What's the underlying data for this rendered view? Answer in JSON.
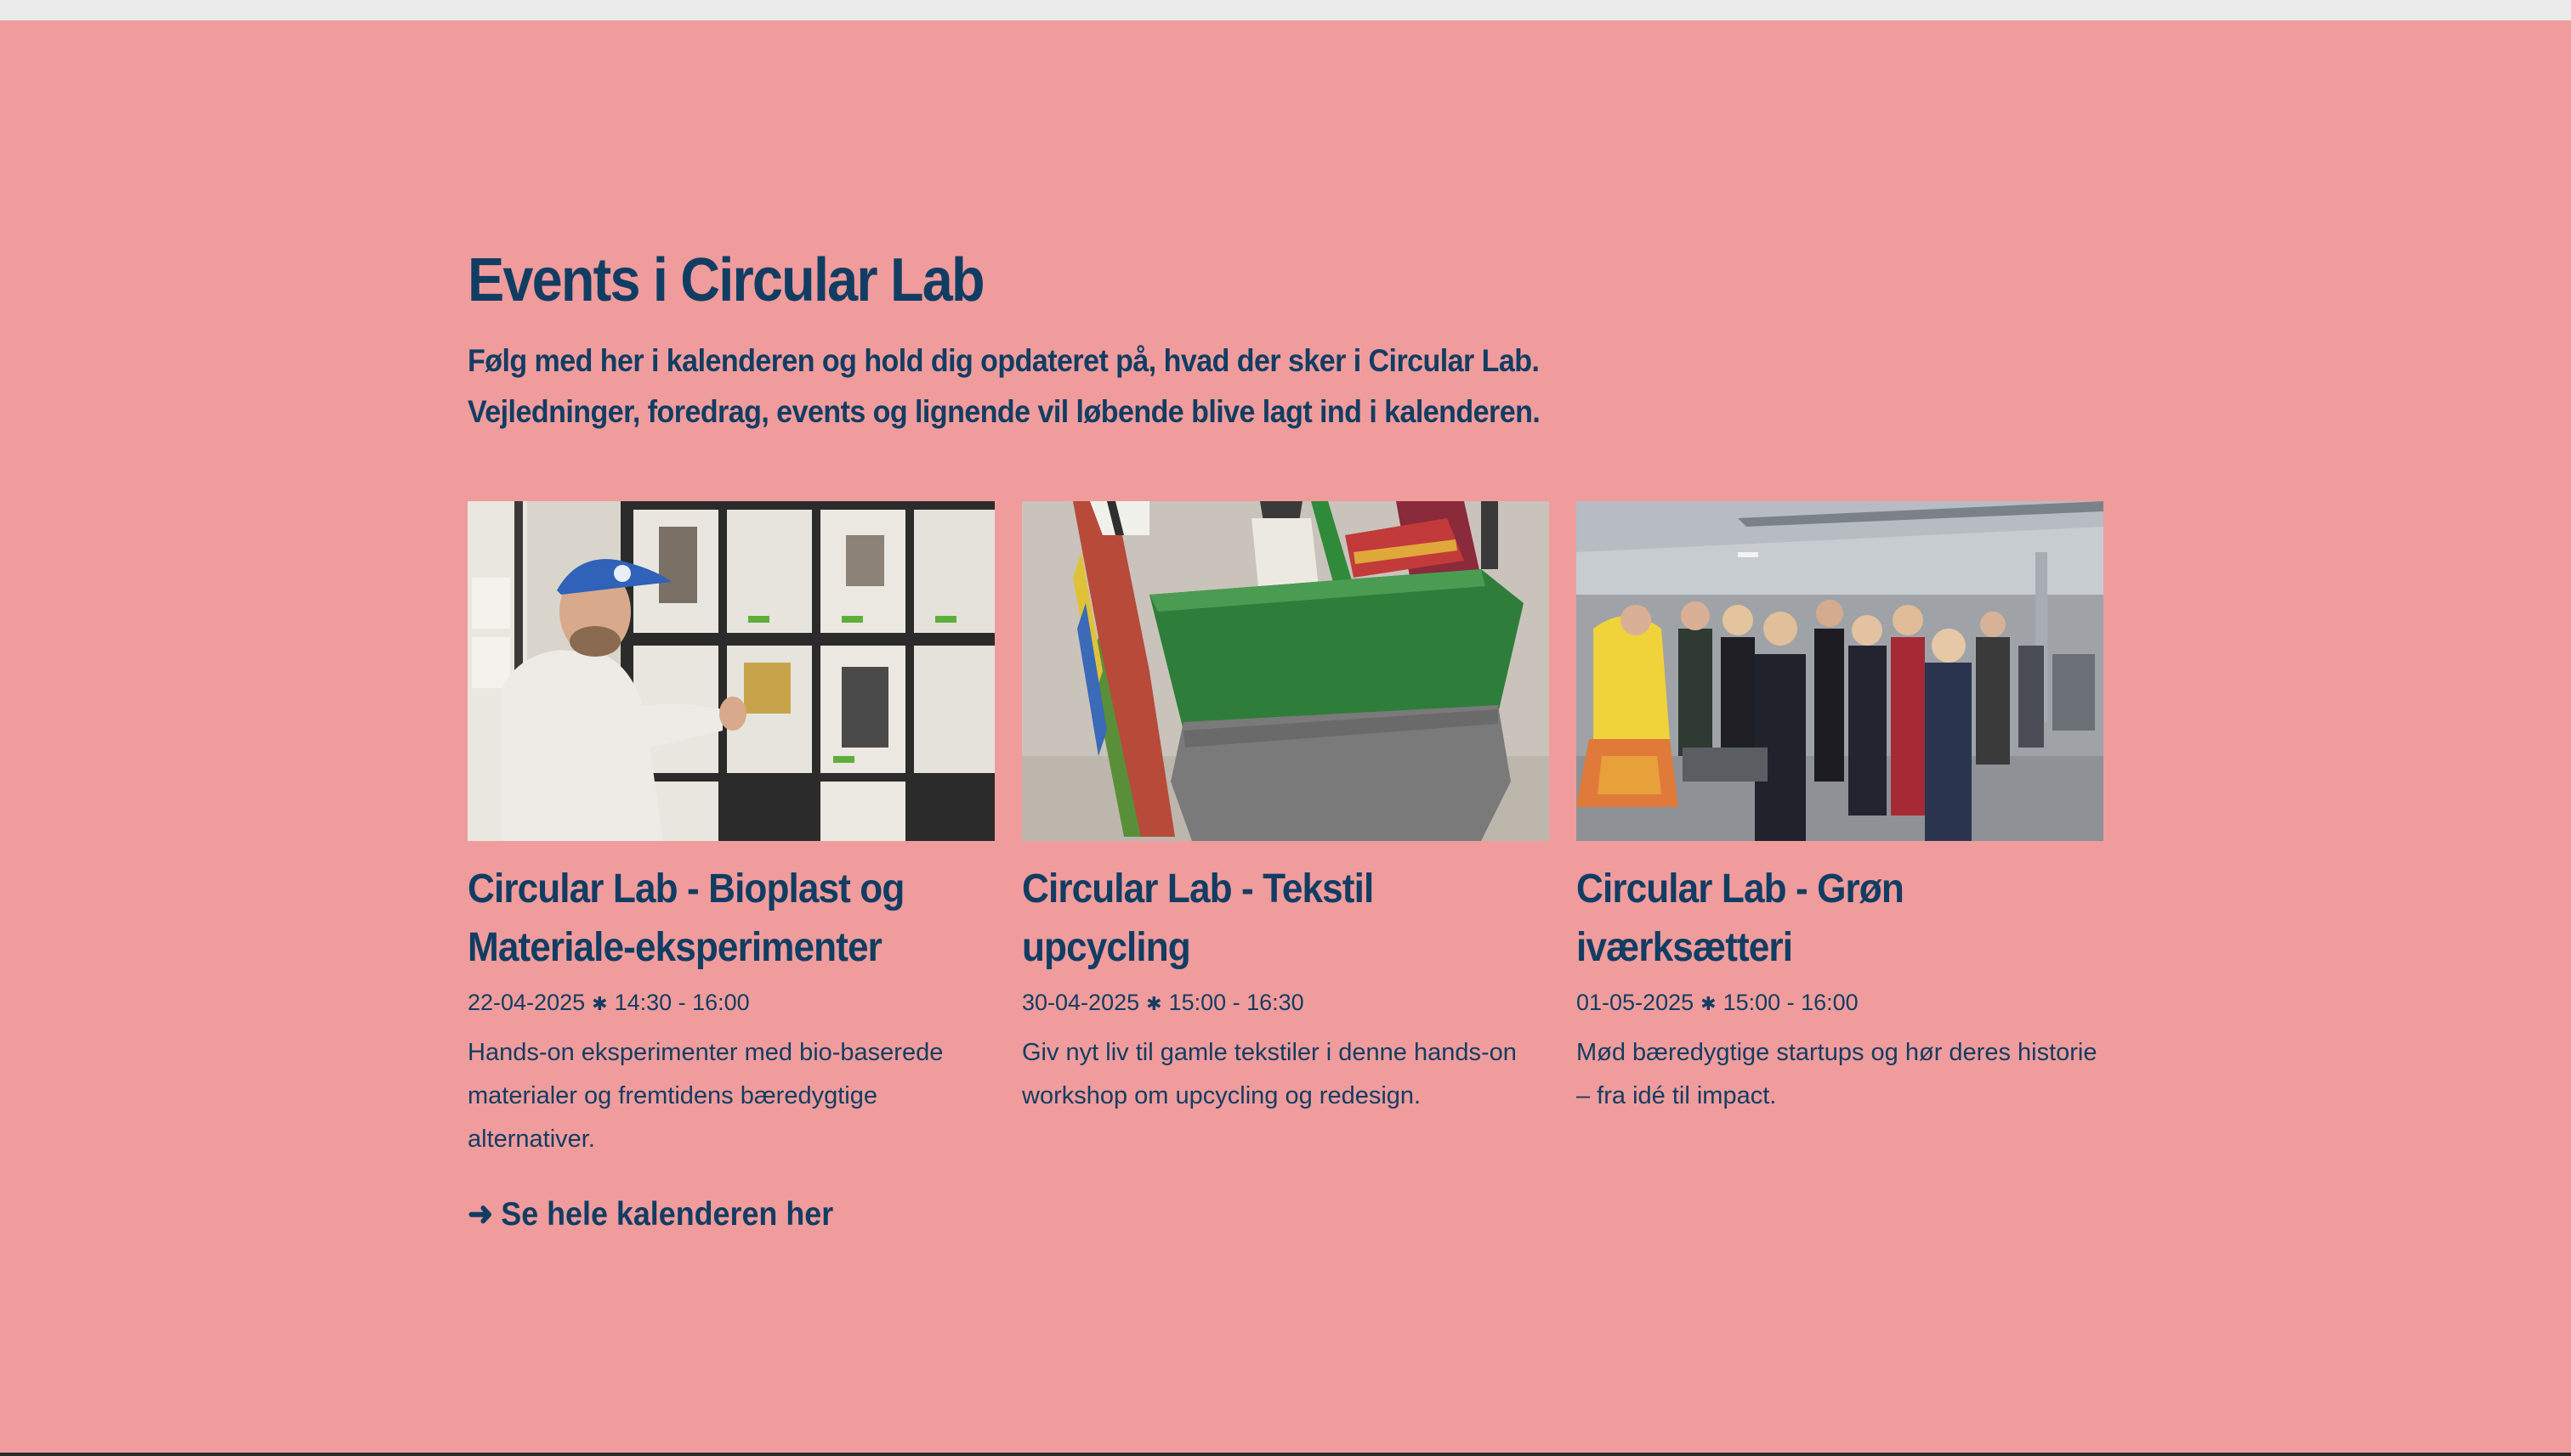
{
  "section": {
    "title": "Events i Circular Lab",
    "intro": "Følg med her i kalenderen og hold dig opdateret på, hvad der sker i Circular Lab. Vejledninger, foredrag, events og lignende vil løbende blive lagt ind i kalenderen."
  },
  "events": [
    {
      "title_line1": "Circular Lab - Bioplast og",
      "title_line2": "Materiale-eksperimenter",
      "date": "22-04-2025",
      "time": "14:30 - 16:00",
      "description": "Hands-on eksperimenter med bio-baserede materialer og fremtidens bæredygtige alternativer."
    },
    {
      "title_line1": "Circular Lab - Tekstil",
      "title_line2": "upcycling",
      "date": "30-04-2025",
      "time": "15:00 - 16:30",
      "description": "Giv nyt liv til gamle tekstiler i denne hands-on workshop om upcycling og redesign."
    },
    {
      "title_line1": "Circular Lab - Grøn",
      "title_line2": "iværksætteri",
      "date": "01-05-2025",
      "time": "15:00 - 16:00",
      "description": "Mød bæredygtige startups og hør deres historie – fra idé til impact."
    }
  ],
  "separator_symbol": "✱",
  "calendar_link": {
    "arrow": "➜",
    "label": "Se hele kalenderen her"
  },
  "colors": {
    "background": "#f09c9c",
    "text": "#123d63"
  }
}
